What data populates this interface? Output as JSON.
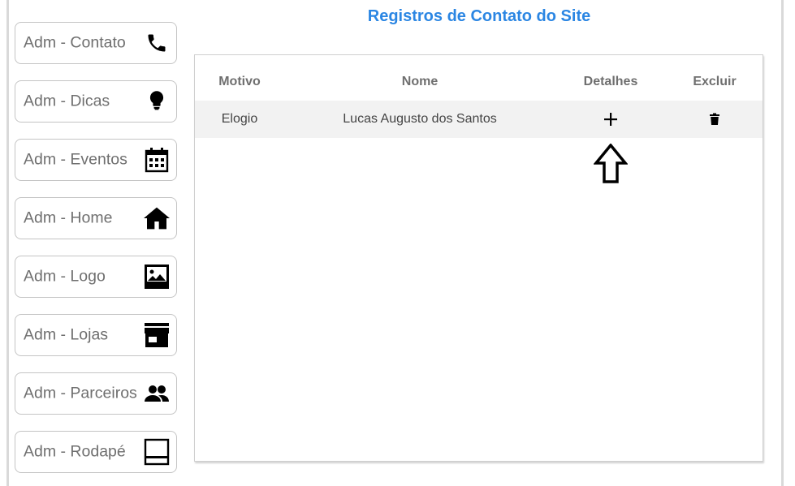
{
  "page": {
    "title": "Registros de Contato do Site"
  },
  "sidebar": {
    "items": [
      {
        "label": "Adm - Contato",
        "icon": "phone-icon"
      },
      {
        "label": "Adm - Dicas",
        "icon": "lightbulb-icon"
      },
      {
        "label": "Adm - Eventos",
        "icon": "calendar-icon"
      },
      {
        "label": "Adm - Home",
        "icon": "home-icon"
      },
      {
        "label": "Adm - Logo",
        "icon": "image-icon"
      },
      {
        "label": "Adm - Lojas",
        "icon": "store-icon"
      },
      {
        "label": "Adm - Parceiros",
        "icon": "people-icon"
      },
      {
        "label": "Adm - Rodapé",
        "icon": "footer-icon"
      }
    ]
  },
  "table": {
    "headers": {
      "motivo": "Motivo",
      "nome": "Nome",
      "detalhes": "Detalhes",
      "excluir": "Excluir"
    },
    "rows": [
      {
        "motivo": "Elogio",
        "nome": "Lucas Augusto dos Santos",
        "detalhes_icon": "plus-icon",
        "excluir_icon": "trash-icon"
      }
    ]
  },
  "annotation": {
    "icon": "up-arrow-icon"
  },
  "colors": {
    "title": "#2b86e3",
    "row_bg": "#f2f2f2",
    "border": "#c4c4c4",
    "text_muted": "#6f6f6f"
  }
}
